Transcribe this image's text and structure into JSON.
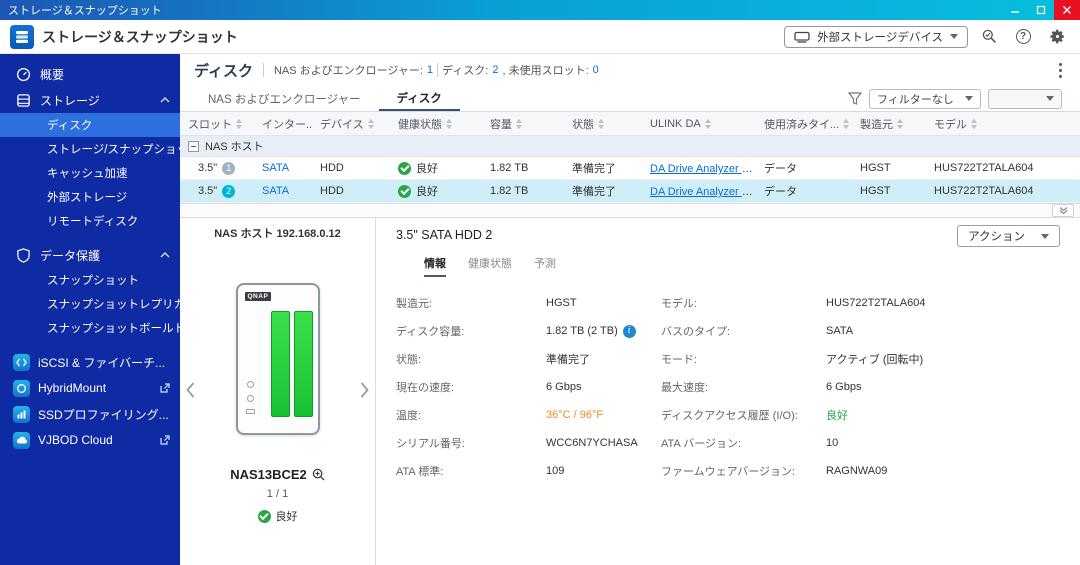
{
  "colors": {
    "link": "#0a6cd6",
    "sidebar": "#0f2ba3",
    "sidebar_selected": "#2e6fe0",
    "selected_row": "#cfeef8",
    "green": "#27a844",
    "orange": "#f08c1e",
    "cyan_badge": "#00b4d8",
    "close_red": "#e81123"
  },
  "titlebar": {
    "title": "ストレージ＆スナップショット"
  },
  "header": {
    "title": "ストレージ＆スナップショット",
    "external_storage_button": "外部ストレージデバイス"
  },
  "sidebar": {
    "items": [
      {
        "label": "概要"
      },
      {
        "label": "ストレージ"
      },
      {
        "label": "ディスク"
      },
      {
        "label": "ストレージ/スナップショット"
      },
      {
        "label": "キャッシュ加速"
      },
      {
        "label": "外部ストレージ"
      },
      {
        "label": "リモートディスク"
      },
      {
        "label": "データ保護"
      },
      {
        "label": "スナップショット"
      },
      {
        "label": "スナップショットレプリカ"
      },
      {
        "label": "スナップショットボールト"
      },
      {
        "label": "iSCSI & ファイバーチ..."
      },
      {
        "label": "HybridMount"
      },
      {
        "label": "SSDプロファイリング..."
      },
      {
        "label": "VJBOD Cloud"
      }
    ]
  },
  "toolbar": {
    "page_title": "ディスク",
    "summary": {
      "nas_label": "NAS およびエンクロージャー:",
      "nas_value": "1",
      "disk_label": "ディスク:",
      "disk_value": "2",
      "slot_label": ", 未使用スロット:",
      "slot_value": "0"
    },
    "tabs": [
      {
        "label": "NAS およびエンクロージャー"
      },
      {
        "label": "ディスク"
      }
    ],
    "filter_select": "フィルターなし"
  },
  "table": {
    "columns": [
      "スロット",
      "インター...",
      "デバイス",
      "健康状態",
      "容量",
      "状態",
      "ULINK DA",
      "使用済みタイ...",
      "製造元",
      "モデル"
    ],
    "group_label": "NAS ホスト",
    "rows": [
      {
        "slot": "3.5\"",
        "num": "1",
        "interface": "SATA",
        "device": "HDD",
        "health": "良好",
        "capacity": "1.82 TB",
        "status": "準備完了",
        "ulink": "DA Drive Analyzer を...",
        "used": "データ",
        "vendor": "HGST",
        "model": "HUS722T2TALA604"
      },
      {
        "slot": "3.5\"",
        "num": "2",
        "interface": "SATA",
        "device": "HDD",
        "health": "良好",
        "capacity": "1.82 TB",
        "status": "準備完了",
        "ulink": "DA Drive Analyzer を...",
        "used": "データ",
        "vendor": "HGST",
        "model": "HUS722T2TALA604"
      }
    ]
  },
  "nas_panel": {
    "host_label": "NAS ホスト 192.168.0.12",
    "device_logo": "QNAP",
    "name": "NAS13BCE2",
    "pager": "1 / 1",
    "health": "良好"
  },
  "detail": {
    "title": "3.5\" SATA HDD 2",
    "action_button": "アクション",
    "tabs": [
      "情報",
      "健康状態",
      "予測"
    ],
    "fields_left": [
      {
        "label": "製造元:",
        "value": "HGST"
      },
      {
        "label": "ディスク容量:",
        "value": "1.82 TB (2 TB)"
      },
      {
        "label": "状態:",
        "value": "準備完了"
      },
      {
        "label": "現在の速度:",
        "value": "6 Gbps"
      },
      {
        "label": "温度:",
        "value": "36°C / 96°F"
      },
      {
        "label": "シリアル番号:",
        "value": "WCC6N7YCHASA"
      },
      {
        "label": "ATA 標準:",
        "value": "109"
      }
    ],
    "fields_right": [
      {
        "label": "モデル:",
        "value": "HUS722T2TALA604"
      },
      {
        "label": "バスのタイプ:",
        "value": "SATA"
      },
      {
        "label": "モード:",
        "value": "アクティブ (回転中)"
      },
      {
        "label": "最大速度:",
        "value": "6 Gbps"
      },
      {
        "label": "ディスクアクセス履歴 (I/O):",
        "value": "良好"
      },
      {
        "label": "ATA バージョン:",
        "value": "10"
      },
      {
        "label": "ファームウェアバージョン:",
        "value": "RAGNWA09"
      }
    ]
  }
}
